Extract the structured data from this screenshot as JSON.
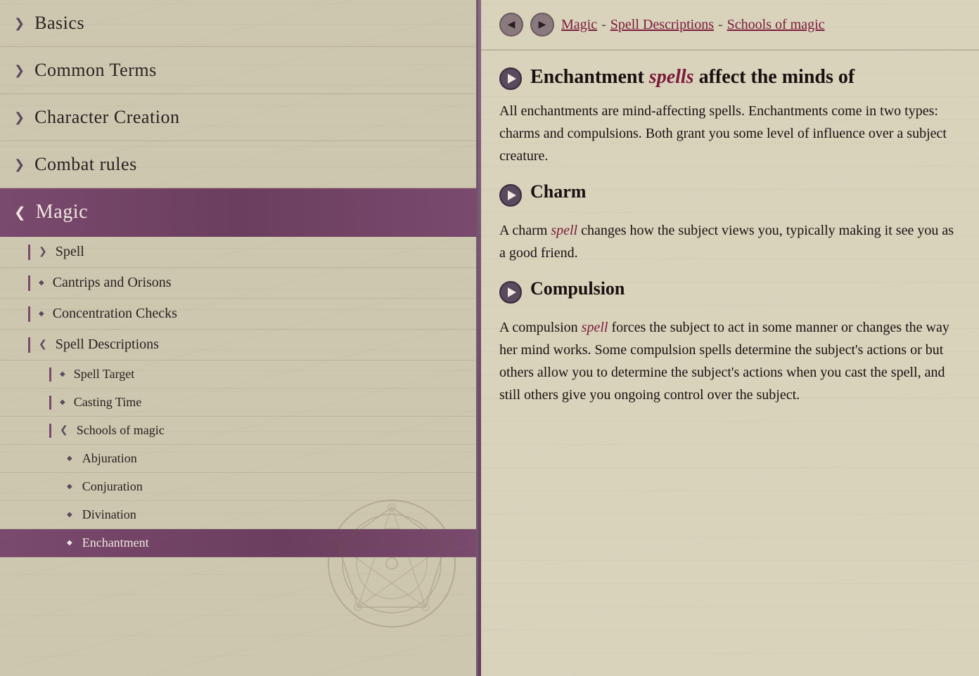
{
  "sidebar": {
    "items": [
      {
        "id": "basics",
        "label": "Basics",
        "arrow": "❯",
        "level": "top"
      },
      {
        "id": "common-terms",
        "label": "Common Terms",
        "arrow": "❯",
        "level": "top"
      },
      {
        "id": "character-creation",
        "label": "Character Creation",
        "arrow": "❯",
        "level": "top"
      },
      {
        "id": "combat-rules",
        "label": "Combat rules",
        "arrow": "❯",
        "level": "top"
      },
      {
        "id": "magic",
        "label": "Magic",
        "arrow": "❮",
        "level": "top",
        "active": true
      }
    ],
    "magic_subitems": [
      {
        "id": "spell",
        "label": "Spell",
        "arrow": "❯"
      },
      {
        "id": "cantrips",
        "label": "Cantrips and Orisons",
        "arrow": "◆"
      },
      {
        "id": "concentration",
        "label": "Concentration Checks",
        "arrow": "◆"
      },
      {
        "id": "spell-descriptions",
        "label": "Spell Descriptions",
        "arrow": "❮",
        "expanded": true
      }
    ],
    "spell_desc_subitems": [
      {
        "id": "spell-target",
        "label": "Spell Target",
        "arrow": "◆"
      },
      {
        "id": "casting-time",
        "label": "Casting Time",
        "arrow": "◆"
      },
      {
        "id": "schools-of-magic",
        "label": "Schools of magic",
        "arrow": "❮",
        "expanded": true
      }
    ],
    "schools_subitems": [
      {
        "id": "abjuration",
        "label": "Abjuration",
        "diamond": "◆"
      },
      {
        "id": "conjuration",
        "label": "Conjuration",
        "diamond": "◆"
      },
      {
        "id": "divination",
        "label": "Divination",
        "diamond": "◆"
      },
      {
        "id": "enchantment",
        "label": "Enchantment",
        "diamond": "◆",
        "active": true
      }
    ]
  },
  "breadcrumb": {
    "back_btn": "◀",
    "forward_btn": "▶",
    "links": [
      {
        "label": "Magic",
        "href": true
      },
      {
        "label": " - ",
        "sep": true
      },
      {
        "label": "Spell Descriptions",
        "href": true
      },
      {
        "label": " - ",
        "sep": true
      },
      {
        "label": "Schools of magic",
        "href": true
      }
    ]
  },
  "content": {
    "main_heading": "Enchantment",
    "main_highlight": "spells",
    "main_text_after": "affect the minds of",
    "intro_text": "All enchantments are mind-affecting spells. Enchantments come in two types: charms and compulsions. Both grant you some level of influence over a subject creature.",
    "sections": [
      {
        "id": "charm",
        "title": "Charm",
        "highlight_word": "spell",
        "text": "A charm spell changes how the subject views you, typically making it see you as a good friend."
      },
      {
        "id": "compulsion",
        "title": "Compulsion",
        "highlight_word": "spell",
        "text": "A compulsion spell forces the subject to act in some manner or changes the way her mind works. Some compulsion spells determine the subject's actions or but others allow you to determine the subject's actions when you cast the spell, and still others give you ongoing control over the subject."
      }
    ]
  }
}
